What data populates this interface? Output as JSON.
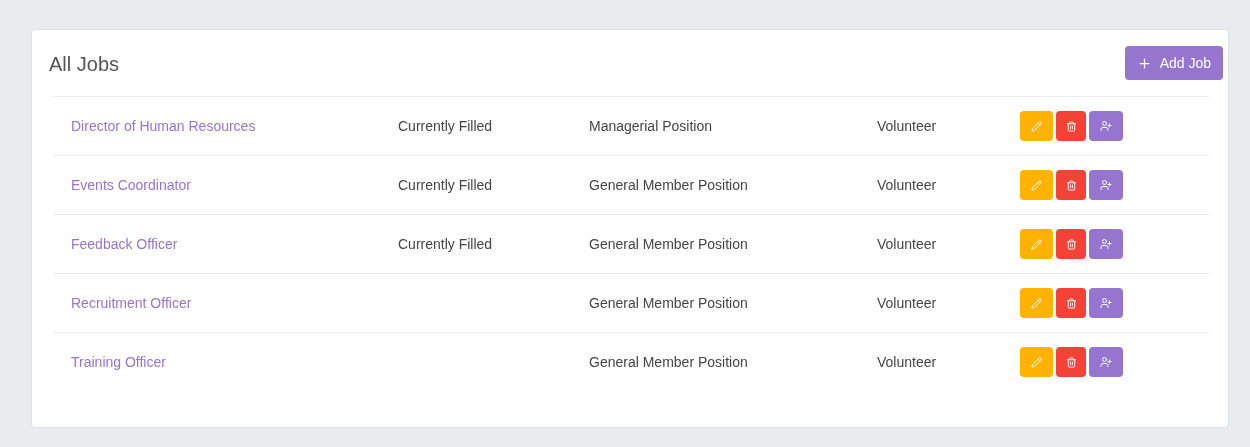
{
  "panel": {
    "title": "All Jobs",
    "add_button": {
      "label": "Add Job"
    }
  },
  "jobs": [
    {
      "title": "Director of Human Resources",
      "status": "Currently Filled",
      "position": "Managerial Position",
      "type": "Volunteer"
    },
    {
      "title": "Events Coordinator",
      "status": "Currently Filled",
      "position": "General Member Position",
      "type": "Volunteer"
    },
    {
      "title": "Feedback Officer",
      "status": "Currently Filled",
      "position": "General Member Position",
      "type": "Volunteer"
    },
    {
      "title": "Recruitment Officer",
      "position": "General Member Position",
      "type": "Volunteer"
    },
    {
      "title": "Training Officer",
      "position": "General Member Position",
      "type": "Volunteer"
    }
  ]
}
